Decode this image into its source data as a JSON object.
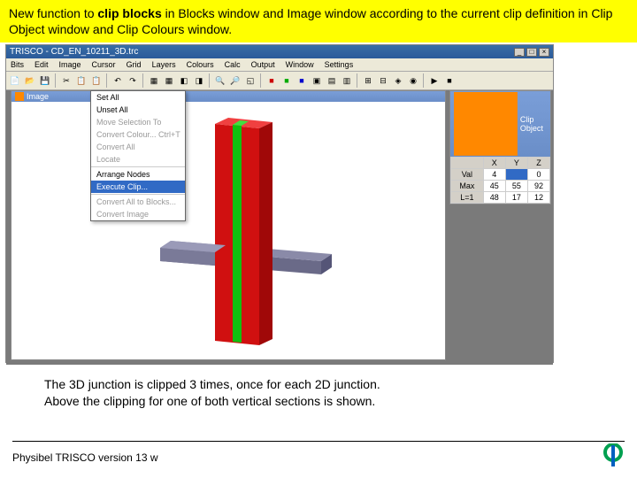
{
  "banner": {
    "prefix": "New function to ",
    "bold": "clip blocks",
    "rest": " in Blocks window and Image window according to the current clip definition in Clip Object window and Clip Colours window."
  },
  "titlebar": {
    "text": "TRISCO - CD_EN_10211_3D.trc"
  },
  "menus": [
    "Bits",
    "Edit",
    "Image",
    "Cursor",
    "Grid",
    "Layers",
    "Colours",
    "Calc",
    "Output",
    "Window",
    "Settings"
  ],
  "dropdown": {
    "items": [
      {
        "label": "Set All",
        "dis": false
      },
      {
        "label": "Unset All",
        "dis": false
      },
      {
        "label": "Move Selection To",
        "dis": true
      },
      {
        "label": "Convert Colour...  Ctrl+T",
        "dis": true
      },
      {
        "label": "Convert All",
        "dis": true
      },
      {
        "label": "Locate",
        "dis": true
      }
    ],
    "arrange": "Arrange Nodes",
    "execute": "Execute Clip...",
    "items2": [
      {
        "label": "Convert All to Blocks...",
        "dis": true
      },
      {
        "label": "Convert Image",
        "dis": true
      }
    ]
  },
  "imgWindow": {
    "title": "Image"
  },
  "clipWindow": {
    "title": "Clip Object",
    "headers": [
      "",
      "X",
      "Y",
      "Z"
    ],
    "rows": [
      {
        "label": "Val",
        "cells": [
          "4",
          "",
          "0"
        ]
      },
      {
        "label": "Max",
        "cells": [
          "45",
          "55",
          "92"
        ]
      },
      {
        "label": "L=1",
        "cells": [
          "48",
          "17",
          "12"
        ]
      }
    ],
    "hlCell": "0"
  },
  "caption": {
    "line1": "The 3D junction is clipped 3 times, once for each 2D junction.",
    "line2": "Above the clipping for one of both vertical sections is shown."
  },
  "footer": {
    "text": "Physibel TRISCO version 13 w"
  }
}
